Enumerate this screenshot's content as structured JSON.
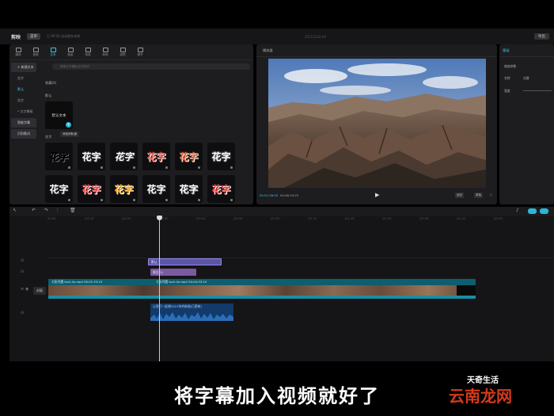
{
  "app": {
    "logo": "剪映",
    "menu": "菜单",
    "status": "已 09:26 自动保存本地",
    "project_title": "20211216-09",
    "export_label": "导出"
  },
  "toolbar": [
    {
      "label": "媒体"
    },
    {
      "label": "音频"
    },
    {
      "label": "文本"
    },
    {
      "label": "贴纸"
    },
    {
      "label": "特效"
    },
    {
      "label": "转场"
    },
    {
      "label": "滤镜"
    },
    {
      "label": "调节"
    }
  ],
  "left_nav": [
    {
      "label": "+ 新建文本"
    },
    {
      "label": "花字"
    },
    {
      "label": "默认"
    },
    {
      "label": "花字"
    },
    {
      "label": "• 文字模板"
    },
    {
      "label": "智能字幕"
    },
    {
      "label": "识别歌词"
    }
  ],
  "search_placeholder": "搜索文字模板/花字样式",
  "section_favorites": "收藏(0)",
  "section_default": "默认",
  "default_tile": "默认文本",
  "add_tooltip": "添加到轨道",
  "section_fancy": "花字",
  "fancy_tiles": [
    {
      "text": "花字",
      "color": "#ffffff"
    },
    {
      "text": "花字",
      "color": "#ffffff"
    },
    {
      "text": "花字",
      "color": "#ffffff"
    },
    {
      "text": "花字",
      "color": "#e0453a"
    },
    {
      "text": "花字",
      "color": "#e85a2c"
    },
    {
      "text": "花字",
      "color": "#ffffff"
    },
    {
      "text": "花字",
      "color": "#ffffff"
    },
    {
      "text": "花字",
      "color": "#e23b3b"
    },
    {
      "text": "花字",
      "color": "#f2a51a"
    },
    {
      "text": "花字",
      "color": "#ffffff"
    },
    {
      "text": "花字",
      "color": "#ffffff"
    },
    {
      "text": "花字",
      "color": "#e23b3b"
    }
  ],
  "player": {
    "title": "播放器",
    "time_current": "00:01:58:00",
    "time_total": "00:06:19:23",
    "btn_ratio": "适应",
    "btn_original": "原始"
  },
  "inspector": {
    "tab": "基础",
    "section": "缩放参数",
    "row1_label": "名称",
    "row1_value": "分屏",
    "row2_label": "强度"
  },
  "timeline": {
    "ruler": [
      "00:00",
      "|00:10",
      "|00:20",
      "|00:30",
      "|00:40",
      "|00:50",
      "|01:00",
      "|01:10",
      "|01:20",
      "|01:30",
      "|01:40",
      "|01:50",
      "|02:00"
    ],
    "text_clip": "默认",
    "effect_clip": "黑白(2)",
    "video_clip_label": "七彩丹霞 tuck.lix.mp4   00:01:33:10",
    "video_clip_label2": "七彩丹霞 tuck.lix.mp4   00:04:33:10",
    "cover_label": "封面",
    "audio_clip": "让我们一起唱2021年的新曲(已更新)"
  },
  "subtitle": "将字幕加入视频就好了",
  "watermark_top": "天奇生活",
  "watermark_bottom": "云南龙网"
}
